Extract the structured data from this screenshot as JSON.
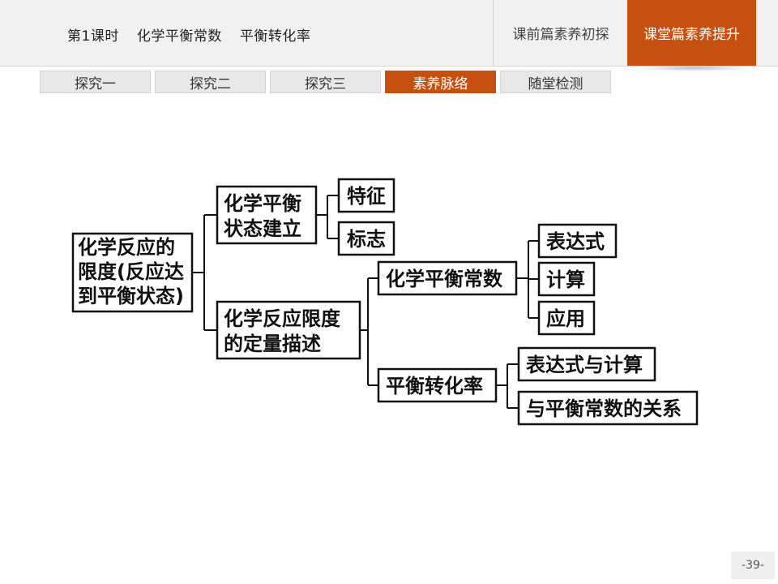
{
  "header": {
    "lesson": "第1课时",
    "title": "化学平衡常数",
    "subtitle": "平衡转化率",
    "nav": [
      "课前篇素养初探",
      "课堂篇素养提升"
    ]
  },
  "subtabs": [
    "探究一",
    "探究二",
    "探究三",
    "素养脉络",
    "随堂检测"
  ],
  "diagram": {
    "root": [
      "化学反应的",
      "限度(反应达",
      "到平衡状态)"
    ],
    "l1a": [
      "化学平衡",
      "状态建立"
    ],
    "l1b": [
      "化学反应限度",
      "的定量描述"
    ],
    "feature": "特征",
    "sign": "标志",
    "constant": "化学平衡常数",
    "conversion": "平衡转化率",
    "expr": "表达式",
    "calc": "计算",
    "apply": "应用",
    "expr_calc": "表达式与计算",
    "relation": "与平衡常数的关系"
  },
  "footer": {
    "page": "-39-"
  }
}
